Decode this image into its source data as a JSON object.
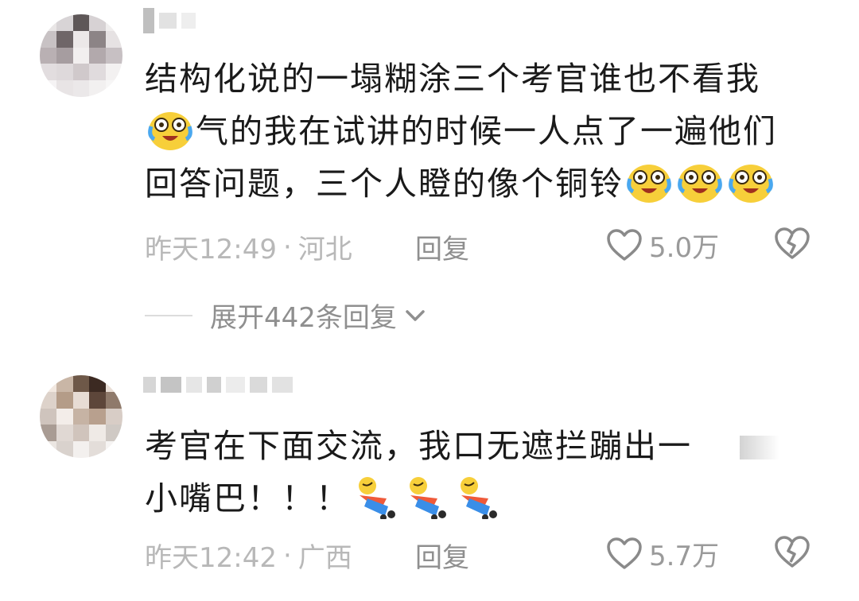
{
  "comments": [
    {
      "text_line1": "结构化说的一塌糊涂三个考官谁也不看我",
      "text_line2": "气的我在试讲的时候一人点了一遍他们",
      "text_line3": "回答问题，三个人瞪的像个铜铃",
      "time": "昨天12:49",
      "separator": "·",
      "location": "河北",
      "reply_label": "回复",
      "likes": "5.0万",
      "emoji": "crying-laughing-emoji"
    },
    {
      "text_line1": "考官在下面交流，我口无遮拦蹦出一",
      "text_line2": "小嘴巴！！！",
      "time": "昨天12:42",
      "separator": "·",
      "location": "广西",
      "reply_label": "回复",
      "likes": "5.7万",
      "emoji": "falling-over-emoji"
    }
  ],
  "expand": {
    "label": "展开442条回复"
  },
  "colors": {
    "text": "#1a1a1a",
    "meta": "#b8b8b8",
    "reply": "#8f8f8f",
    "icon": "#9a9a9a"
  }
}
